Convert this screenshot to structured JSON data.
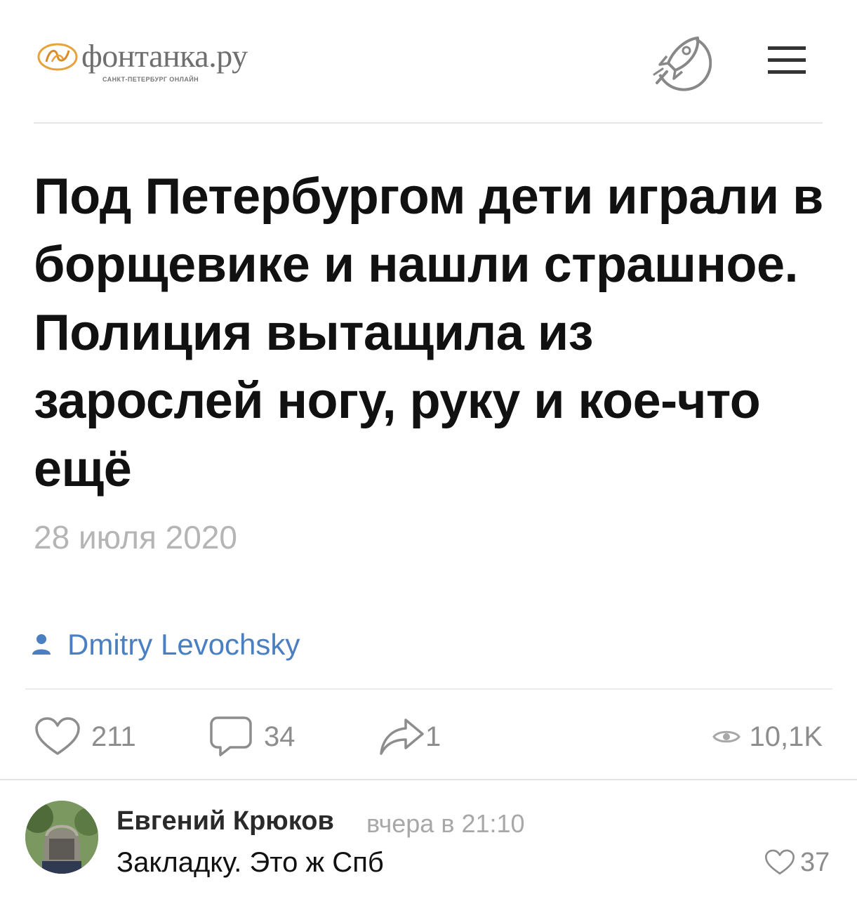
{
  "header": {
    "logo_text": "фонтанка.ру",
    "logo_subtitle": "САНКТ-ПЕТЕРБУРГ ОНЛАЙН",
    "icons": [
      "logo-mark-icon",
      "rocket-icon",
      "menu-icon"
    ]
  },
  "article": {
    "headline": "Под Петербургом дети играли в борщевике и нашли страшное. Полиция вытащила из зарослей ногу, руку и кое-что ещё",
    "date": "28 июля 2020"
  },
  "author": {
    "name": "Dmitry Levochsky",
    "icon": "person-icon"
  },
  "actions": {
    "likes": "211",
    "comments": "34",
    "shares": "1",
    "views": "10,1K"
  },
  "comment": {
    "author": "Евгений Крюков",
    "time": "вчера в 21:10",
    "text": "Закладку. Это ж Спб",
    "likes": "37"
  },
  "colors": {
    "accent_link": "#4a7fc2",
    "muted": "#8d8d8d",
    "logo_orange": "#e8a23a"
  }
}
